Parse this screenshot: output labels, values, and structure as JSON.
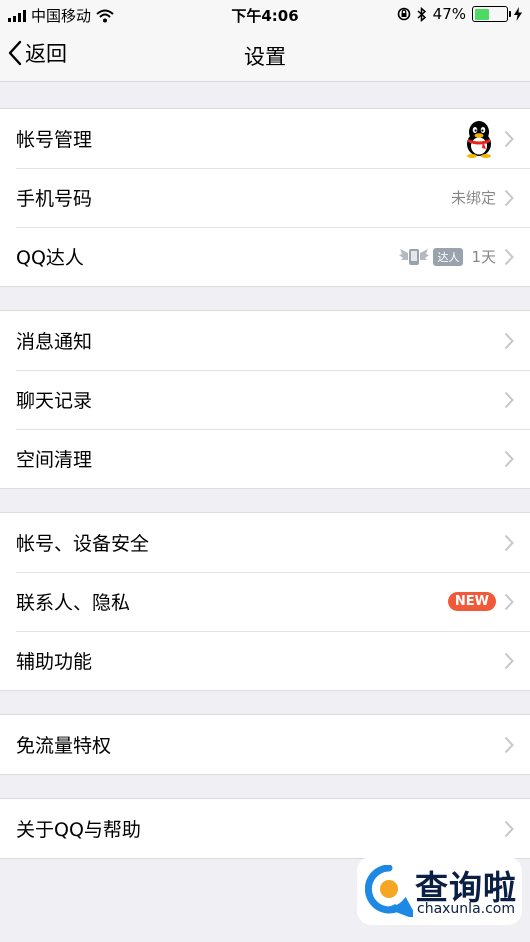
{
  "status_bar": {
    "carrier": "中国移动",
    "time": "下午4:06",
    "battery_percent": "47%",
    "battery_level": 0.47
  },
  "nav": {
    "back_label": "返回",
    "title": "设置"
  },
  "groups": [
    {
      "items": [
        {
          "label": "帐号管理",
          "accessory": "qq-penguin-avatar"
        },
        {
          "label": "手机号码",
          "value": "未绑定"
        },
        {
          "label": "QQ达人",
          "badge": "达人",
          "value": "1天"
        }
      ]
    },
    {
      "items": [
        {
          "label": "消息通知"
        },
        {
          "label": "聊天记录"
        },
        {
          "label": "空间清理"
        }
      ]
    },
    {
      "items": [
        {
          "label": "帐号、设备安全"
        },
        {
          "label": "联系人、隐私",
          "badge": "NEW"
        },
        {
          "label": "辅助功能"
        }
      ]
    },
    {
      "items": [
        {
          "label": "免流量特权"
        }
      ]
    },
    {
      "items": [
        {
          "label": "关于QQ与帮助"
        }
      ]
    }
  ],
  "watermark": {
    "title": "查询啦",
    "url": "chaxunla.com"
  },
  "colors": {
    "background": "#efeff4",
    "new_badge": "#f05a3a",
    "battery_fill": "#4cd964",
    "chevron": "#c7c7cc"
  }
}
